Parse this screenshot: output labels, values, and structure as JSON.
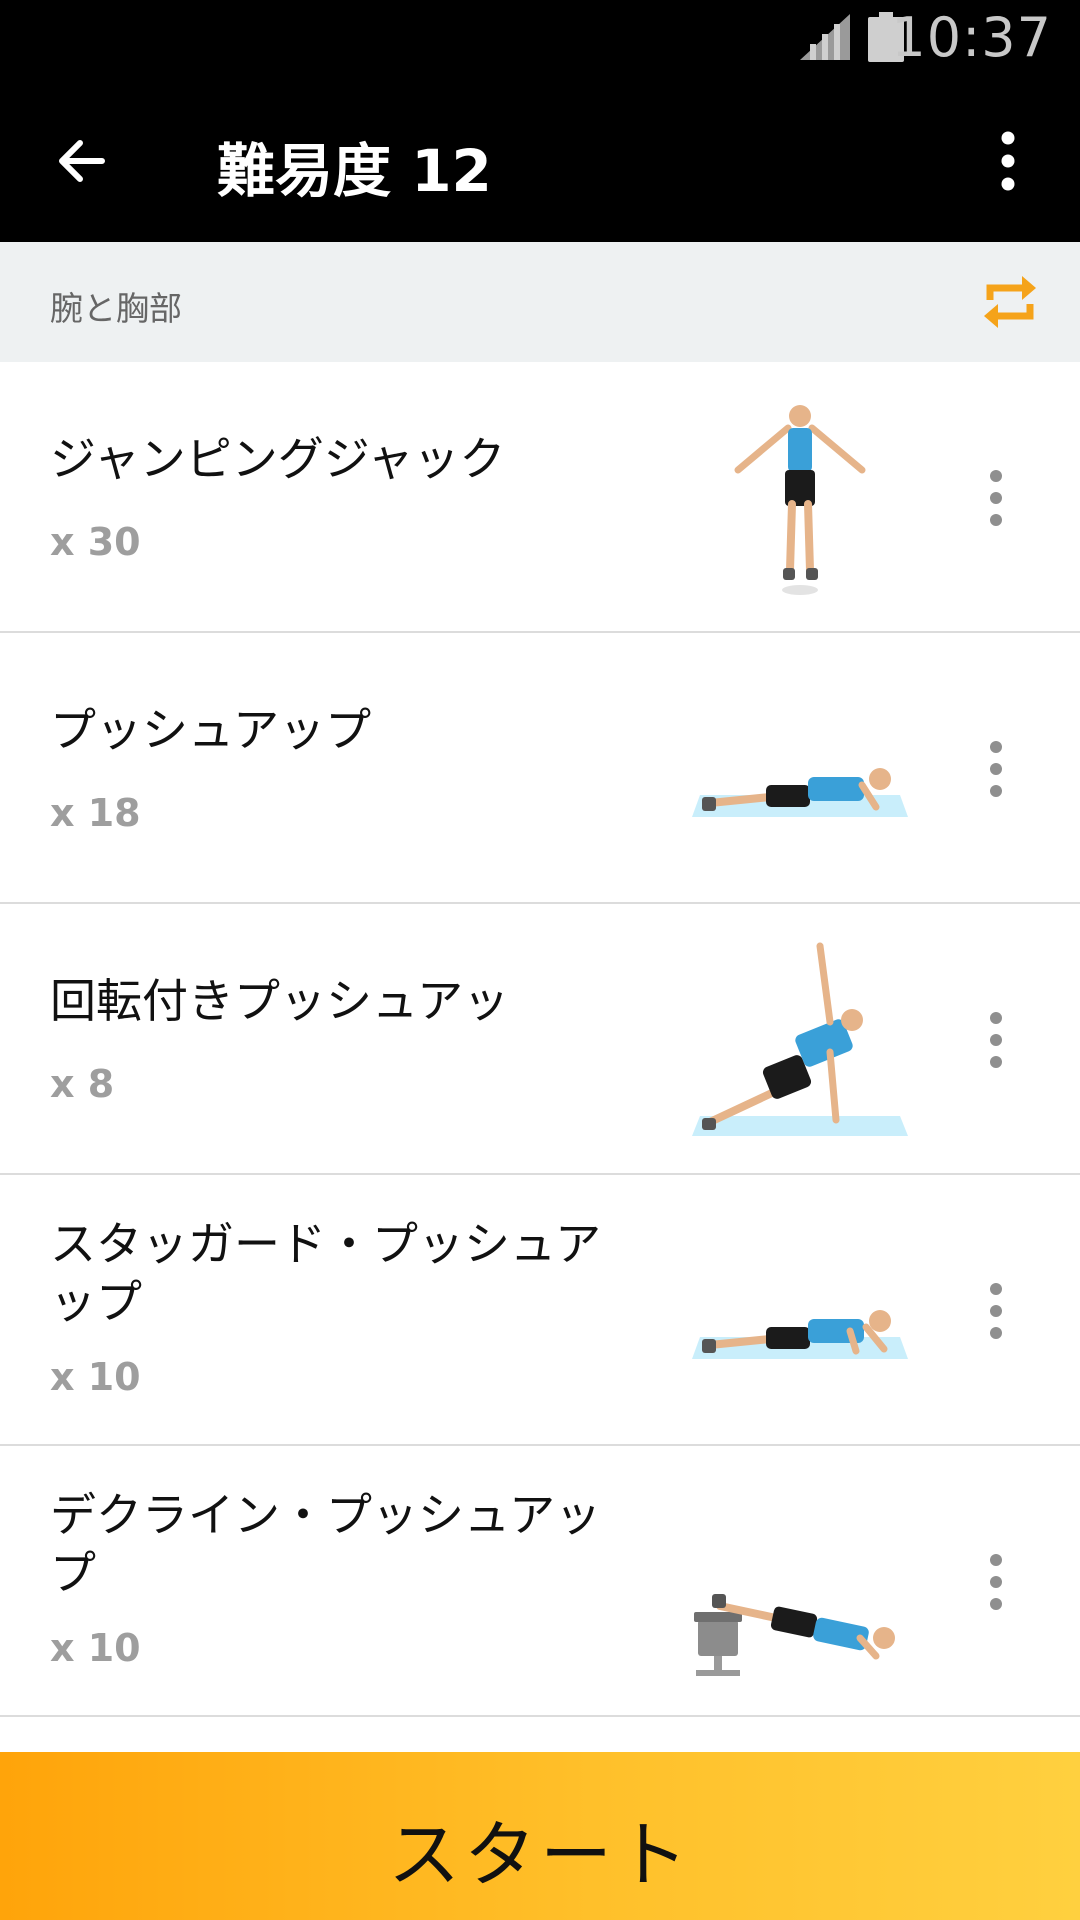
{
  "status_bar": {
    "time": "10:37",
    "icons": [
      "signal-icon",
      "battery-icon"
    ]
  },
  "app_bar": {
    "title": "難易度 12",
    "back_icon": "arrow-left-icon",
    "menu_icon": "more-vert-icon"
  },
  "section": {
    "label": "腕と胸部",
    "action_icon": "repeat-icon",
    "accent": "#f5a31a"
  },
  "exercises": [
    {
      "name": "ジャンピングジャック",
      "count": "x 30",
      "image": "jumping-jack-figure"
    },
    {
      "name": "プッシュアップ",
      "count": "x 18",
      "image": "push-up-figure"
    },
    {
      "name": "回転付きプッシュアッ",
      "count": "x 8",
      "image": "rotation-push-up-figure"
    },
    {
      "name": "スタッガード・プッシュアップ",
      "count": "x 10",
      "image": "staggered-push-up-figure"
    },
    {
      "name": "デクライン・プッシュアップ",
      "count": "x 10",
      "image": "decline-push-up-figure"
    }
  ],
  "start_button": {
    "label": "スタート",
    "color": "#ffb31f"
  }
}
